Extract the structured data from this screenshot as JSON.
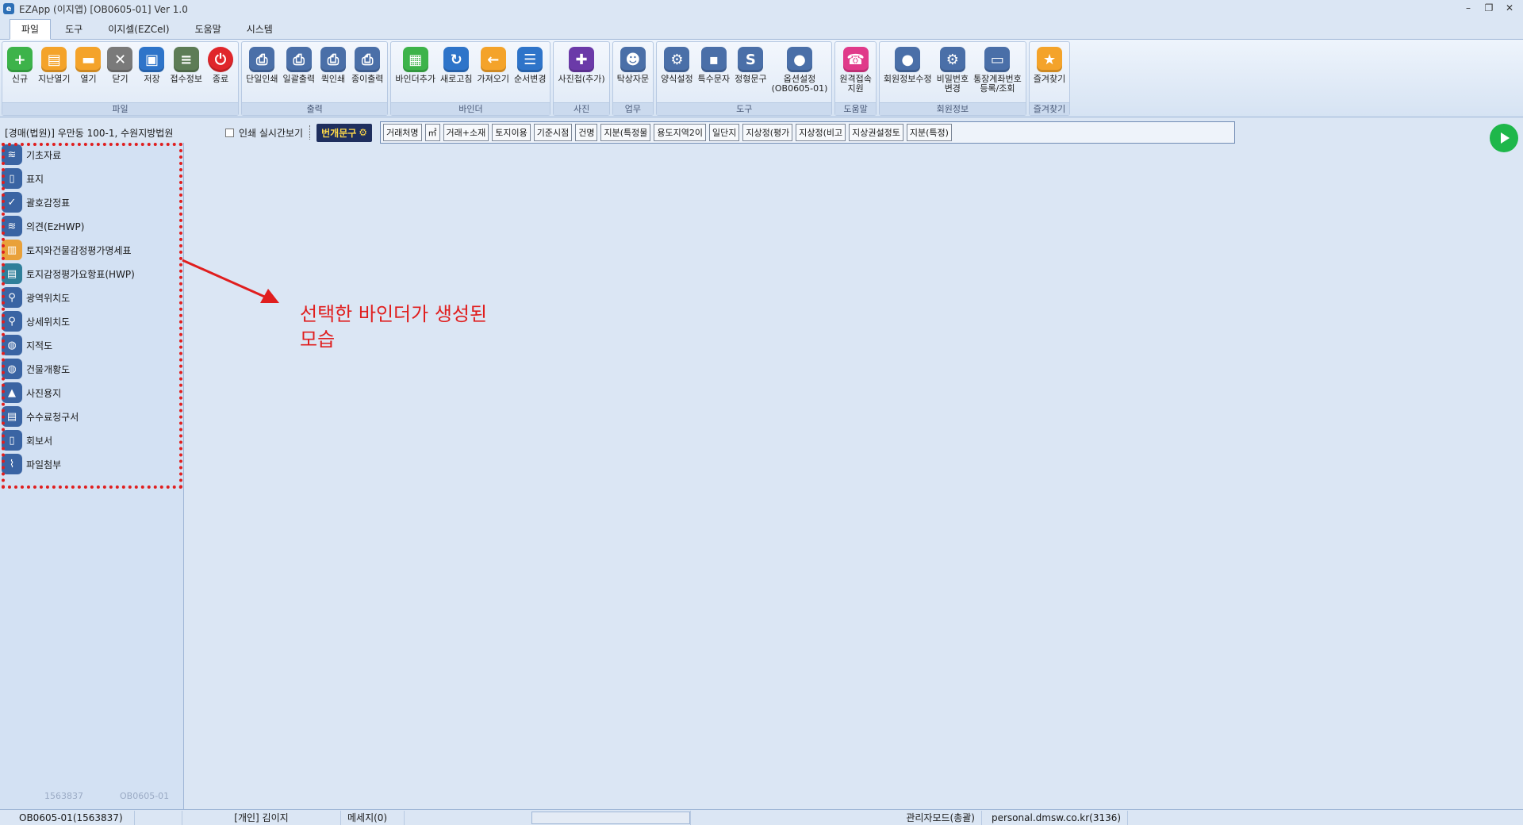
{
  "window": {
    "title": "EZApp (이지앱) [OB0605-01] Ver 1.0",
    "icon": "app-logo-icon",
    "controls": [
      "–",
      "❐",
      "✕"
    ]
  },
  "tabs": [
    "파일",
    "도구",
    "이지셀(EZCel)",
    "도움말",
    "시스템"
  ],
  "ribbon": {
    "groups": [
      {
        "label": "파일",
        "buttons": [
          {
            "label": "신규",
            "icon": "plus-icon",
            "color": "green"
          },
          {
            "label": "지난열기",
            "icon": "recent-folder-icon",
            "color": "orange"
          },
          {
            "label": "열기",
            "icon": "folder-icon",
            "color": "orange"
          },
          {
            "label": "닫기",
            "icon": "close-icon",
            "color": "gray"
          },
          {
            "label": "저장",
            "icon": "save-icon",
            "color": "blue"
          },
          {
            "label": "접수정보",
            "icon": "receipt-icon",
            "color": "darkgreen"
          },
          {
            "label": "종료",
            "icon": "power-icon",
            "color": "red"
          }
        ]
      },
      {
        "label": "출력",
        "buttons": [
          {
            "label": "단일인쇄",
            "icon": "print-single-icon",
            "color": "steel"
          },
          {
            "label": "일괄출력",
            "icon": "print-all-icon",
            "color": "steel"
          },
          {
            "label": "퀵인쇄",
            "icon": "print-quick-icon",
            "color": "steel"
          },
          {
            "label": "종이출력",
            "icon": "print-paper-icon",
            "color": "steel"
          }
        ]
      },
      {
        "label": "바인더",
        "buttons": [
          {
            "label": "바인더추가",
            "icon": "binder-add-icon",
            "color": "green"
          },
          {
            "label": "새로고침",
            "icon": "refresh-icon",
            "color": "blue"
          },
          {
            "label": "가져오기",
            "icon": "import-icon",
            "color": "orange"
          },
          {
            "label": "순서변경",
            "icon": "reorder-icon",
            "color": "blue"
          }
        ]
      },
      {
        "label": "사진",
        "buttons": [
          {
            "label": "사진첩(추가)",
            "icon": "photo-add-icon",
            "color": "purple"
          }
        ]
      },
      {
        "label": "업무",
        "buttons": [
          {
            "label": "탁상자문",
            "icon": "consult-icon",
            "color": "steel"
          }
        ]
      },
      {
        "label": "도구",
        "buttons": [
          {
            "label": "양식설정",
            "icon": "form-settings-icon",
            "color": "steel"
          },
          {
            "label": "특수문자",
            "icon": "special-char-icon",
            "color": "steel"
          },
          {
            "label": "정형문구",
            "icon": "phrase-icon",
            "color": "steel"
          },
          {
            "label": "옵션설정\n(OB0605-01)",
            "icon": "user-settings-icon",
            "color": "steel"
          }
        ]
      },
      {
        "label": "도움말",
        "buttons": [
          {
            "label": "원격접속\n지원",
            "icon": "remote-support-icon",
            "color": "pink"
          }
        ]
      },
      {
        "label": "회원정보",
        "buttons": [
          {
            "label": "회원정보수정",
            "icon": "member-edit-icon",
            "color": "steel"
          },
          {
            "label": "비밀번호\n변경",
            "icon": "password-icon",
            "color": "steel"
          },
          {
            "label": "통장계좌번호\n등록/조회",
            "icon": "bank-account-icon",
            "color": "steel"
          }
        ]
      },
      {
        "label": "즐겨찾기",
        "buttons": [
          {
            "label": "즐겨찾기",
            "icon": "star-icon",
            "color": "star"
          }
        ]
      }
    ]
  },
  "toolbar": {
    "case_label": "[경매(법원)] 우만동 100-1, 수원지방법원",
    "print_preview_label": "인쇄 실시간보기",
    "phrase_button": "번개문구",
    "chips": [
      "거래처명",
      "㎡",
      "거래+소재",
      "토지이용",
      "기준시점",
      "건명",
      "지분(특정물",
      "용도지역2이",
      "일단지",
      "지상정(평가",
      "지상정(비고",
      "지상권설정토",
      "지분(특정)"
    ]
  },
  "sidebar": {
    "items": [
      {
        "label": "기초자료",
        "icon": "stack-icon",
        "color": "blue"
      },
      {
        "label": "표지",
        "icon": "cover-icon",
        "color": "blue"
      },
      {
        "label": "괄호감정표",
        "icon": "stamp-icon",
        "color": "blue"
      },
      {
        "label": "의견(EzHWP)",
        "icon": "opinion-icon",
        "color": "blue"
      },
      {
        "label": "토지와건물감정평가명세표",
        "icon": "table-icon",
        "color": "orange"
      },
      {
        "label": "토지감정평가요항표(HWP)",
        "icon": "map-table-icon",
        "color": "teal"
      },
      {
        "label": "광역위치도",
        "icon": "location-pin-icon",
        "color": "blue"
      },
      {
        "label": "상세위치도",
        "icon": "detail-pin-icon",
        "color": "blue"
      },
      {
        "label": "지적도",
        "icon": "cadastral-map-icon",
        "color": "blue"
      },
      {
        "label": "건물개황도",
        "icon": "building-map-icon",
        "color": "blue"
      },
      {
        "label": "사진용지",
        "icon": "photo-icon",
        "color": "blue"
      },
      {
        "label": "수수료청구서",
        "icon": "invoice-icon",
        "color": "blue"
      },
      {
        "label": "회보서",
        "icon": "clipboard-icon",
        "color": "blue"
      },
      {
        "label": "파일첨부",
        "icon": "paperclip-icon",
        "color": "blue"
      }
    ],
    "footer_left": "1563837",
    "footer_right": "OB0605-01"
  },
  "annotation": {
    "line1": "선택한 바인더가 생성된",
    "line2": "모습",
    "color": "#e01e1e"
  },
  "statusbar": {
    "id": "OB0605-01(1563837)",
    "user": "[개인] 김이지",
    "messages": "메세지(0)",
    "mode": "관리자모드(총괄)",
    "site": "personal.dmsw.co.kr(3136)"
  }
}
